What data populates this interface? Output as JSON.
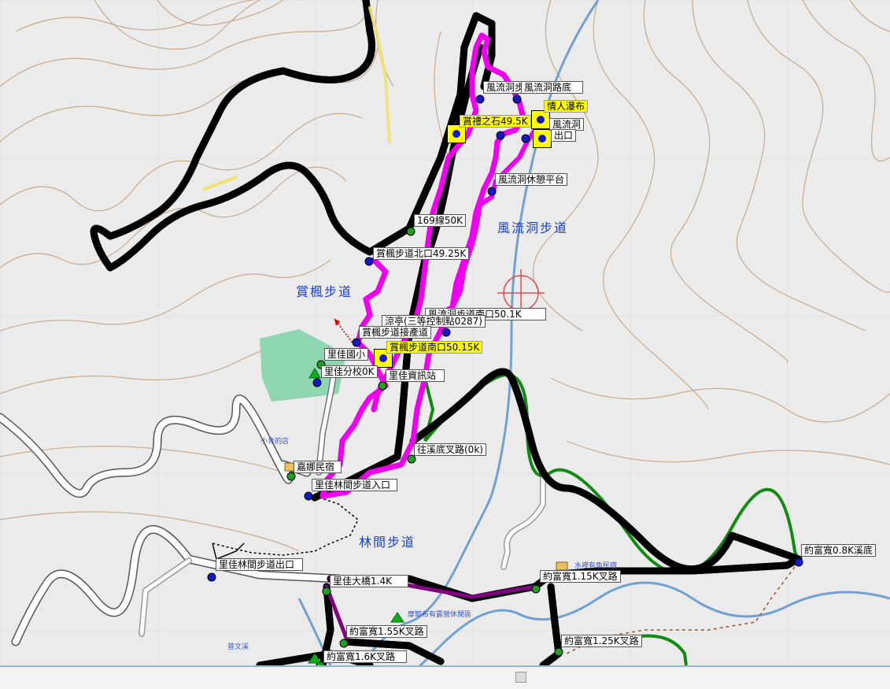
{
  "map": {
    "waypoints": [
      {
        "id": "fengliudong-1",
        "label": "風流洞步"
      },
      {
        "id": "fengliudong-bottom",
        "label": "風流洞路底"
      },
      {
        "id": "lovers-falls",
        "label": "情人瀑布"
      },
      {
        "id": "shangli-stone",
        "label": "賞禮之石49.5K"
      },
      {
        "id": "fengliudong-2",
        "label": "風流洞"
      },
      {
        "id": "fengliudong-3",
        "label": "出口"
      },
      {
        "id": "fengliudong-rest",
        "label": "風流洞休憩平台"
      },
      {
        "id": "route169-50k",
        "label": "169線50K"
      },
      {
        "id": "shangfeng-north",
        "label": "賞楓步道北口49.25K"
      },
      {
        "id": "fengliudong-south",
        "label": "風流洞步道南口50.1K"
      },
      {
        "id": "pavilion",
        "label": "涼亭(三等控制點0287)"
      },
      {
        "id": "shangfeng-connect",
        "label": "賞楓步道接產道"
      },
      {
        "id": "lijia-elementary",
        "label": "里佳國小"
      },
      {
        "id": "shangfeng-south",
        "label": "賞楓步道南口50.15K"
      },
      {
        "id": "lijia-branch",
        "label": "里佳分校0K"
      },
      {
        "id": "lijia-info",
        "label": "里佳資訊站"
      },
      {
        "id": "creek-fork",
        "label": "往溪底叉路(0k)"
      },
      {
        "id": "jiana-bnb",
        "label": "嘉娜民宿"
      },
      {
        "id": "forest-entrance",
        "label": "里佳林間步道入口"
      },
      {
        "id": "forest-exit",
        "label": "里佳林間步道出口"
      },
      {
        "id": "lijia-bridge",
        "label": "里佳大橋1.4K"
      },
      {
        "id": "yuefulan-115",
        "label": "約富寬1.15K叉路"
      },
      {
        "id": "yuefulan-08",
        "label": "約富寬0.8K溪底"
      },
      {
        "id": "yuefulan-155",
        "label": "約富寬1.55K叉路"
      },
      {
        "id": "yuefulan-125",
        "label": "約富寬1.25K叉路"
      },
      {
        "id": "yuefulan-16",
        "label": "約富寬1.6K叉路"
      }
    ],
    "areas": [
      {
        "id": "fengliudong-trail",
        "label": "風流洞步道"
      },
      {
        "id": "shangfeng-trail",
        "label": "賞楓步道"
      },
      {
        "id": "forest-trail",
        "label": "林間步道"
      }
    ],
    "pois": [
      {
        "id": "xiaoqing-shop",
        "label": "小青的店"
      },
      {
        "id": "fish-bnb",
        "label": "水裡有魚民宿"
      },
      {
        "id": "camping",
        "label": "摩耶布有露營休閒區"
      },
      {
        "id": "pucreek",
        "label": "普文溪"
      }
    ],
    "colors": {
      "background": "#ebebeb",
      "contour": "#c8a98c",
      "river": "#6fa1d4",
      "main_track": "#1d1d7a",
      "magenta_track": "#ee00ee",
      "green_track": "#108a10",
      "road": "#ffffff",
      "school_area": "#8ed6b0",
      "label_highlight": "#ffff00"
    },
    "icons": [
      "crosshair-icon",
      "waypoint-dot-icon",
      "tent-icon",
      "lodging-icon"
    ]
  }
}
